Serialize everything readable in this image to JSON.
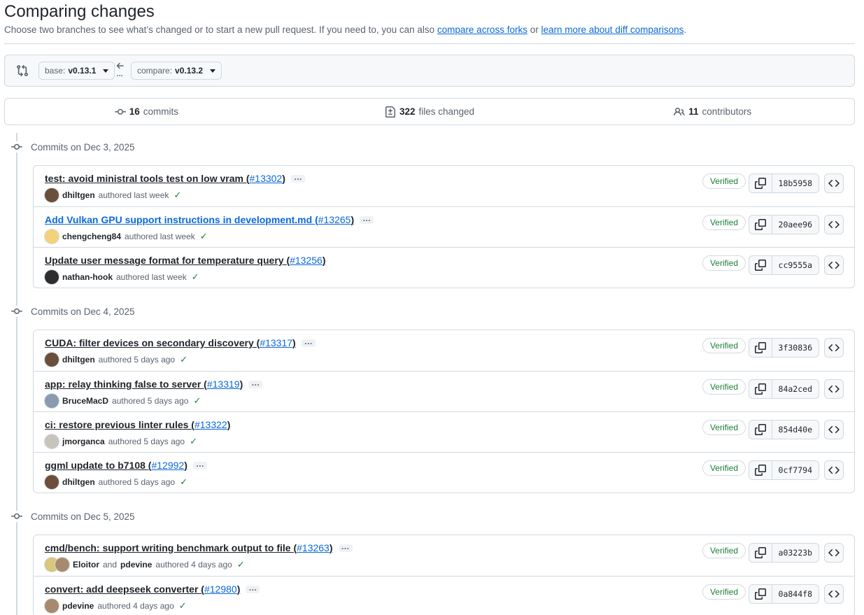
{
  "header": {
    "title": "Comparing changes",
    "subtitle_pre": "Choose two branches to see what’s changed or to start a new pull request. If you need to, you can also",
    "link_forks": "compare across forks",
    "subtitle_or": "or",
    "link_learn": "learn more about diff comparisons",
    "subtitle_end": "."
  },
  "range": {
    "base_label": "base:",
    "base_value": "v0.13.1",
    "compare_label": "compare:",
    "compare_value": "v0.13.2"
  },
  "stats": {
    "commits_count": "16",
    "commits_label": "commits",
    "files_count": "322",
    "files_label": "files changed",
    "contributors_count": "11",
    "contributors_label": "contributors"
  },
  "groups": [
    {
      "date": "Commits on Dec 3, 2025",
      "commits": [
        {
          "title": "test: avoid ministral tools test on low vram (",
          "pr": "#13302",
          "close": ")",
          "author": "dhiltgen",
          "author2": "",
          "and": "",
          "when": "authored last week",
          "badge": "Verified",
          "sha": "18b5958",
          "avatar": "#6b4f3a"
        },
        {
          "title": "Add Vulkan GPU support instructions in development.md (",
          "pr": "#13265",
          "close": ")",
          "author": "chengcheng84",
          "author2": "",
          "and": "",
          "when": "authored last week",
          "badge": "Verified",
          "sha": "20aee96",
          "avatar": "#f4d27a"
        },
        {
          "title": "Update user message format for temperature query (",
          "pr": "#13256",
          "close": ")",
          "author": "nathan-hook",
          "author2": "",
          "and": "",
          "when": "authored last week",
          "badge": "Verified",
          "sha": "cc9555a",
          "avatar": "#2d2d2d"
        }
      ]
    },
    {
      "date": "Commits on Dec 4, 2025",
      "commits": [
        {
          "title": "CUDA: filter devices on secondary discovery (",
          "pr": "#13317",
          "close": ")",
          "author": "dhiltgen",
          "author2": "",
          "and": "",
          "when": "authored 5 days ago",
          "badge": "Verified",
          "sha": "3f30836",
          "avatar": "#6b4f3a"
        },
        {
          "title": "app: relay thinking false to server (",
          "pr": "#13319",
          "close": ")",
          "author": "BruceMacD",
          "author2": "",
          "and": "",
          "when": "authored 5 days ago",
          "badge": "Verified",
          "sha": "84a2ced",
          "avatar": "#8a9bb0"
        },
        {
          "title": "ci: restore previous linter rules (",
          "pr": "#13322",
          "close": ")",
          "author": "jmorganca",
          "author2": "",
          "and": "",
          "when": "authored 5 days ago",
          "badge": "Verified",
          "sha": "854d40e",
          "avatar": "#c9c4bb"
        },
        {
          "title": "ggml update to b7108 (",
          "pr": "#12992",
          "close": ")",
          "author": "dhiltgen",
          "author2": "",
          "and": "",
          "when": "authored 5 days ago",
          "badge": "Verified",
          "sha": "0cf7794",
          "avatar": "#6b4f3a"
        }
      ]
    },
    {
      "date": "Commits on Dec 5, 2025",
      "commits": [
        {
          "title": "cmd/bench: support writing benchmark output to file (",
          "pr": "#13263",
          "close": ")",
          "author": "Eloitor",
          "author2": "pdevine",
          "and": "and",
          "when": "authored 4 days ago",
          "badge": "Verified",
          "sha": "a03223b",
          "avatar": "#d9c77a"
        },
        {
          "title": "convert: add deepseek converter (",
          "pr": "#12980",
          "close": ")",
          "author": "pdevine",
          "author2": "",
          "and": "",
          "when": "authored 4 days ago",
          "badge": "Verified",
          "sha": "0a844f8",
          "avatar": "#a78a6e"
        }
      ]
    }
  ]
}
